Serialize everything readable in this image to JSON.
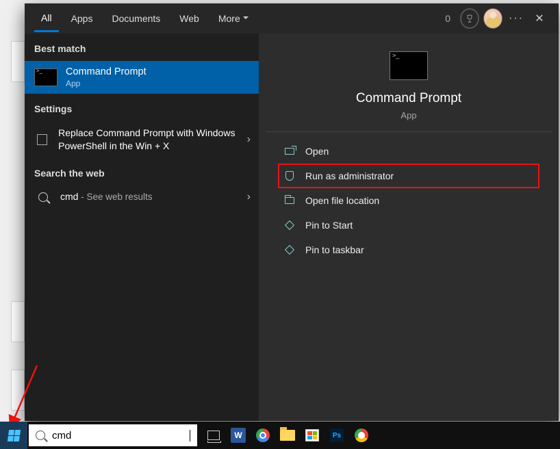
{
  "tabs": {
    "all": "All",
    "apps": "Apps",
    "documents": "Documents",
    "web": "Web",
    "more": "More"
  },
  "topbar": {
    "count": "0"
  },
  "left": {
    "best_match_label": "Best match",
    "best_match": {
      "title": "Command Prompt",
      "sub": "App"
    },
    "settings_label": "Settings",
    "setting_item": "Replace Command Prompt with Windows PowerShell in the Win + X",
    "web_label": "Search the web",
    "web_item": {
      "term": "cmd",
      "suffix": " - See web results"
    }
  },
  "preview": {
    "title": "Command Prompt",
    "sub": "App"
  },
  "actions": {
    "open": "Open",
    "run_admin": "Run as administrator",
    "open_file_location": "Open file location",
    "pin_start": "Pin to Start",
    "pin_taskbar": "Pin to taskbar"
  },
  "search": {
    "value": "cmd"
  }
}
